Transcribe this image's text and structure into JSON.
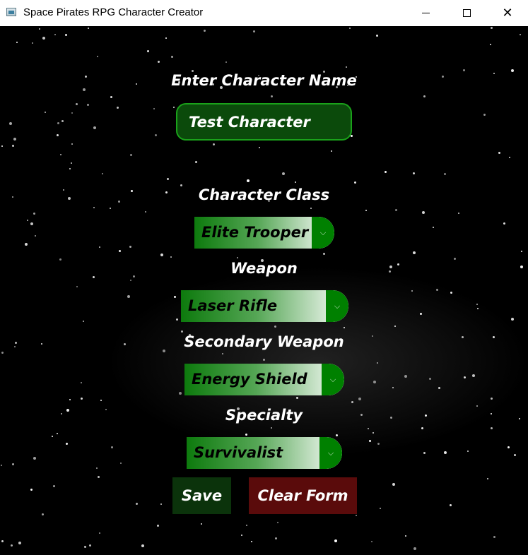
{
  "window": {
    "title": "Space Pirates RPG Character Creator",
    "controls": {
      "minimize": "minimize-icon",
      "maximize": "maximize-icon",
      "close": "close-icon"
    }
  },
  "form": {
    "name_label": "Enter Character Name",
    "name_value": "Test Character",
    "class_label": "Character Class",
    "class_value": "Elite Trooper",
    "weapon_label": "Weapon",
    "weapon_value": "Laser Rifle",
    "secondary_label": "Secondary Weapon",
    "secondary_value": "Energy Shield",
    "specialty_label": "Specialty",
    "specialty_value": "Survivalist",
    "save_label": "Save",
    "clear_label": "Clear Form"
  },
  "colors": {
    "background": "#000000",
    "input_bg": "#0b4a0b",
    "input_border": "#1aa21a",
    "dropdown_arrow_bg": "#008000",
    "save_bg": "#0b330b",
    "clear_bg": "#5a0b0b",
    "label_text": "#ffffff"
  }
}
